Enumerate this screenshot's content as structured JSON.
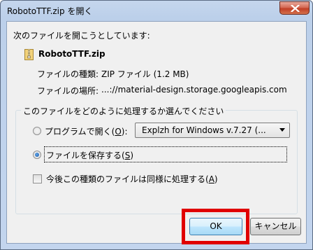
{
  "window": {
    "title": "RobotoTTF.zip を開く"
  },
  "dialog": {
    "intro": "次のファイルを開こうとしています:",
    "file_name": "RobotoTTF.zip",
    "type_label": "ファイルの種類:",
    "type_value": "ZIP ファイル (1.2 MB)",
    "location_label": "ファイルの場所:",
    "location_value": "...://material-design.storage.googleapis.com",
    "group_title": "このファイルをどのように処理するか選んでください",
    "open_with": {
      "label": "プログラムで開く(",
      "accel": "O",
      "suffix": "):",
      "selected": false,
      "program": "Explzh for Windows v.7.27 (..."
    },
    "save_file": {
      "label": "ファイルを保存する(",
      "accel": "S",
      "suffix": ")",
      "selected": true
    },
    "remember": {
      "label": "今後この種類のファイルは同様に処理する(",
      "accel": "A",
      "suffix": ")",
      "checked": false
    },
    "buttons": {
      "ok": "OK",
      "cancel": "キャンセル"
    }
  },
  "colors": {
    "titlebar": "#bcd0ea",
    "client_bg": "#f0f0f0",
    "highlight": "#e00000",
    "close_button": "#c13f26"
  },
  "icons": [
    "close-icon",
    "zip-file-icon",
    "dropdown-arrow-icon"
  ]
}
